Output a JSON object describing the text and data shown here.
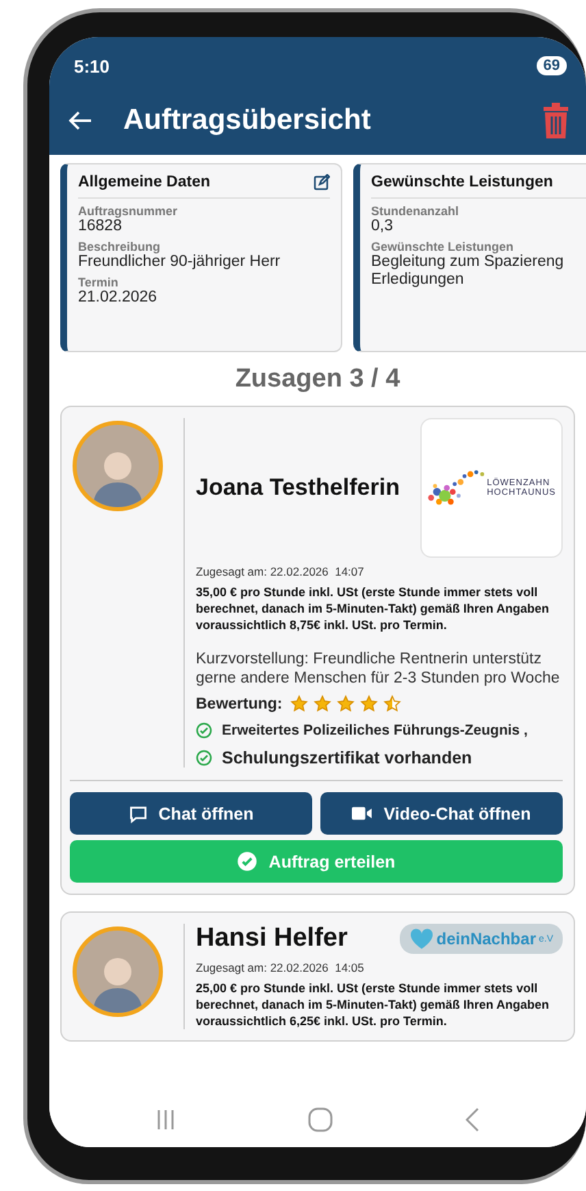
{
  "status_bar": {
    "time": "5:10",
    "battery": "69"
  },
  "header": {
    "title": "Auftragsübersicht"
  },
  "info_cards": [
    {
      "title": "Allgemeine Daten",
      "editable": true,
      "fields": [
        {
          "label": "Auftragsnummer",
          "value": [
            "16828"
          ]
        },
        {
          "label": "Beschreibung",
          "value": [
            "Freundlicher 90-jähriger Herr"
          ]
        },
        {
          "label": "Termin",
          "value": [
            "21.02.2026"
          ]
        }
      ]
    },
    {
      "title": "Gewünschte Leistungen",
      "fields": [
        {
          "label": "Stundenanzahl",
          "value": [
            "0,3"
          ]
        },
        {
          "label": "Gewünschte Leistungen",
          "value": [
            "Begleitung zum Spaziereng",
            "Erledigungen"
          ]
        }
      ]
    }
  ],
  "section_title": "Zusagen 3 / 4",
  "offers": [
    {
      "name": "Joana Testhelferin",
      "logo": {
        "kind": "loewenzahn",
        "text": "LÖWENZAHN",
        "subtext": "HOCHTAUNUS"
      },
      "accepted": "Zugesagt am: 22.02.2026  14:07",
      "price": "35,00 € pro Stunde inkl. USt (erste Stunde immer stets voll berechnet, danach im 5-Minuten-Takt) gemäß Ihren Angaben voraussichtlich 8,75€ inkl. USt. pro Termin.",
      "intro": "Kurzvorstellung: Freundliche Rentnerin unterstütz gerne andere Menschen für 2-3 Stunden pro Woche",
      "rating_label": "Bewertung:",
      "stars": 4.5,
      "certificates": [
        "Erweitertes Polizeiliches Führungs-Zeugnis ,",
        "Schulungszertifikat vorhanden"
      ],
      "buttons": {
        "chat": "Chat öffnen",
        "video": "Video-Chat öffnen",
        "assign": "Auftrag erteilen"
      }
    },
    {
      "name": "Hansi Helfer",
      "logo": {
        "kind": "deinnachbar",
        "text": "deinNachbar",
        "subtext": "e.V"
      },
      "accepted": "Zugesagt am: 22.02.2026  14:05",
      "price": "25,00 € pro Stunde inkl. USt (erste Stunde immer stets voll berechnet, danach im 5-Minuten-Takt) gemäß Ihren Angaben voraussichtlich 6,25€ inkl. USt. pro Termin."
    }
  ]
}
